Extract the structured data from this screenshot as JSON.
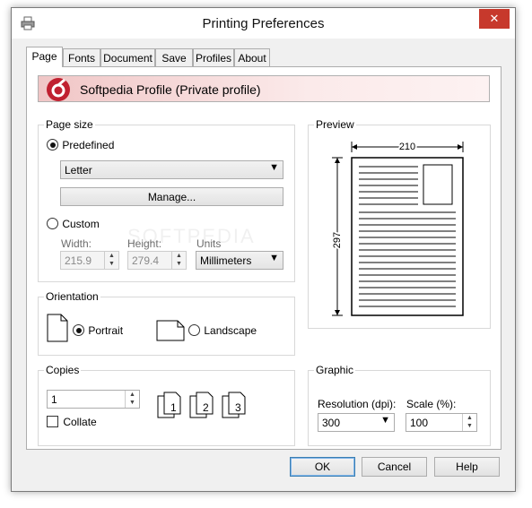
{
  "window": {
    "title": "Printing Preferences",
    "close_glyph": "✕"
  },
  "tabs": [
    "Page",
    "Fonts",
    "Document",
    "Save",
    "Profiles",
    "About"
  ],
  "banner": {
    "text": "Softpedia Profile (Private profile)"
  },
  "page_size": {
    "label": "Page size",
    "predefined_label": "Predefined",
    "predefined_value": "Letter",
    "manage_label": "Manage...",
    "custom_label": "Custom",
    "width_label": "Width:",
    "width_value": "215.9",
    "height_label": "Height:",
    "height_value": "279.4",
    "units_label": "Units",
    "units_value": "Millimeters"
  },
  "orientation": {
    "label": "Orientation",
    "portrait": "Portrait",
    "landscape": "Landscape",
    "selected": "Portrait"
  },
  "copies": {
    "label": "Copies",
    "value": "1",
    "collate_label": "Collate",
    "collate_checked": false,
    "collate_icon_digits": [
      "1",
      "2",
      "3"
    ]
  },
  "preview": {
    "label": "Preview",
    "width_dim": "210",
    "height_dim": "297"
  },
  "graphic": {
    "label": "Graphic",
    "resolution_label": "Resolution (dpi):",
    "resolution_value": "300",
    "scale_label": "Scale (%):",
    "scale_value": "100"
  },
  "footer": {
    "ok": "OK",
    "cancel": "Cancel",
    "help": "Help"
  },
  "watermark": "SOFTPEDIA",
  "colors": {
    "banner_logo": "#c02030",
    "close_bg": "#c7392c",
    "default_border": "#3c7fb1"
  },
  "icons": [
    "printer-icon",
    "softpedia-logo-icon",
    "portrait-page-icon",
    "landscape-page-icon",
    "collate-pages-icon"
  ]
}
